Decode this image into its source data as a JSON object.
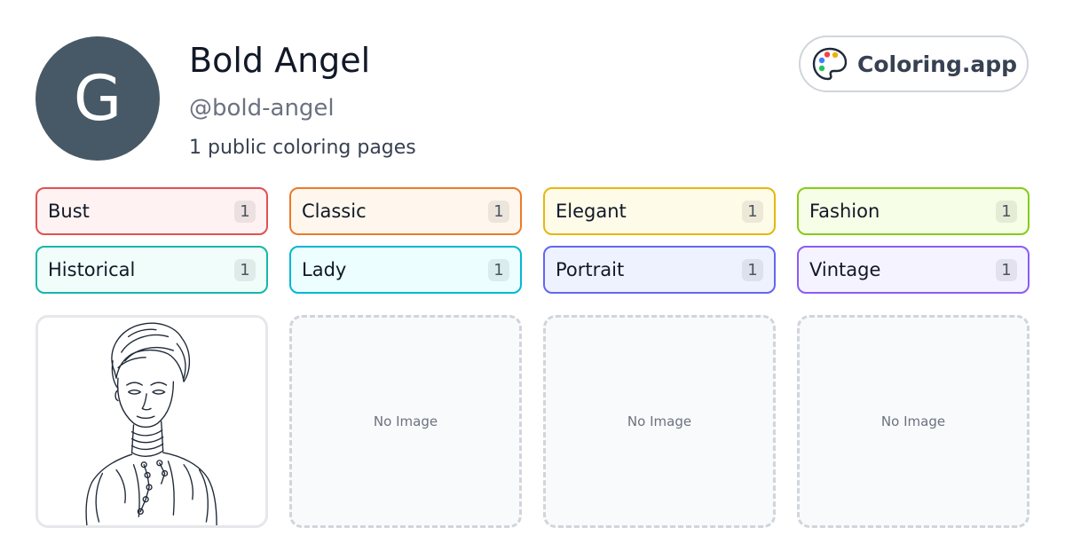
{
  "profile": {
    "avatar_initial": "G",
    "name": "Bold Angel",
    "handle": "@bold-angel",
    "page_count_text": "1 public coloring pages"
  },
  "brand": {
    "label": "Coloring.app",
    "icon": "palette-icon"
  },
  "tags": [
    {
      "label": "Bust",
      "count": "1",
      "border": "#e05252",
      "bg": "#fef2f2"
    },
    {
      "label": "Classic",
      "count": "1",
      "border": "#ec7a2a",
      "bg": "#fff7ed"
    },
    {
      "label": "Elegant",
      "count": "1",
      "border": "#e5b711",
      "bg": "#fefce8"
    },
    {
      "label": "Fashion",
      "count": "1",
      "border": "#84cc16",
      "bg": "#f7fee7"
    },
    {
      "label": "Historical",
      "count": "1",
      "border": "#14b8a6",
      "bg": "#f0fdfa"
    },
    {
      "label": "Lady",
      "count": "1",
      "border": "#06b6d4",
      "bg": "#ecfeff"
    },
    {
      "label": "Portrait",
      "count": "1",
      "border": "#6366f1",
      "bg": "#eef2ff"
    },
    {
      "label": "Vintage",
      "count": "1",
      "border": "#8b5cf6",
      "bg": "#f5f3ff"
    }
  ],
  "cards": [
    {
      "type": "image"
    },
    {
      "type": "empty",
      "text": "No Image"
    },
    {
      "type": "empty",
      "text": "No Image"
    },
    {
      "type": "empty",
      "text": "No Image"
    }
  ]
}
